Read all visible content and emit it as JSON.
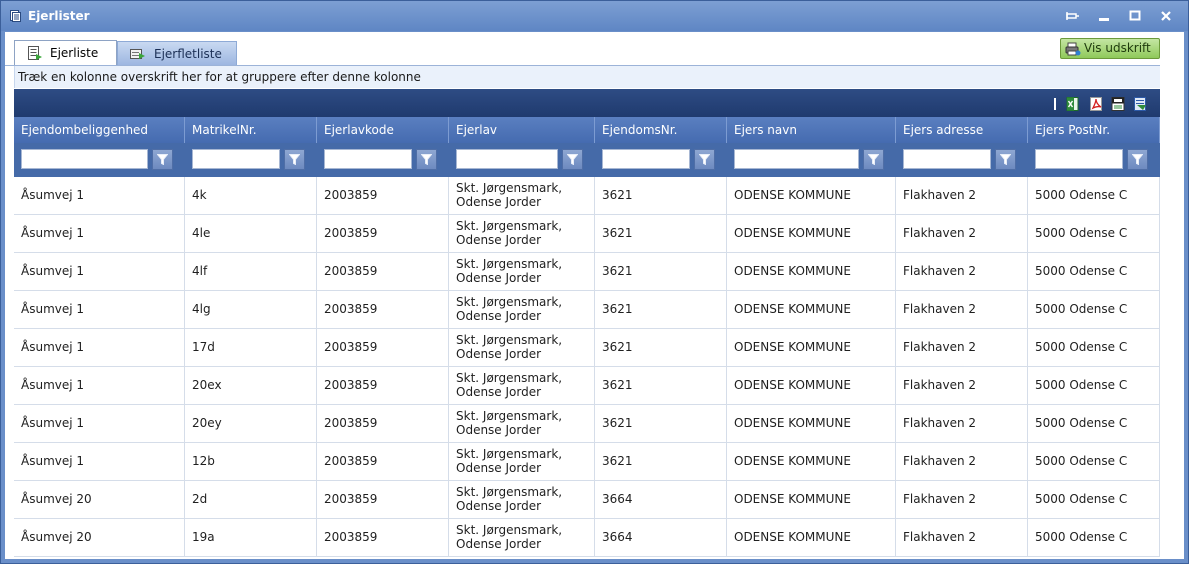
{
  "window": {
    "title": "Ejerlister"
  },
  "tabs": [
    {
      "label": "Ejerliste",
      "active": true
    },
    {
      "label": "Ejerfletliste",
      "active": false
    }
  ],
  "print_button": {
    "label": "Vis udskrift"
  },
  "group_hint": "Træk en kolonne overskrift her for at gruppere efter denne kolonne",
  "toolbar_icons": [
    "excel-export-icon",
    "pdf-export-icon",
    "csv-export-icon",
    "word-export-icon"
  ],
  "columns": [
    "Ejendombeliggenhed",
    "MatrikelNr.",
    "Ejerlavkode",
    "Ejerlav",
    "EjendomsNr.",
    "Ejers navn",
    "Ejers adresse",
    "Ejers PostNr."
  ],
  "filters": [
    "",
    "",
    "",
    "",
    "",
    "",
    "",
    ""
  ],
  "rows": [
    [
      "Åsumvej 1",
      "4k",
      "2003859",
      "Skt. Jørgensmark,\nOdense Jorder",
      "3621",
      "ODENSE KOMMUNE",
      "Flakhaven 2",
      "5000 Odense C"
    ],
    [
      "Åsumvej 1",
      "4le",
      "2003859",
      "Skt. Jørgensmark,\nOdense Jorder",
      "3621",
      "ODENSE KOMMUNE",
      "Flakhaven 2",
      "5000 Odense C"
    ],
    [
      "Åsumvej 1",
      "4lf",
      "2003859",
      "Skt. Jørgensmark,\nOdense Jorder",
      "3621",
      "ODENSE KOMMUNE",
      "Flakhaven 2",
      "5000 Odense C"
    ],
    [
      "Åsumvej 1",
      "4lg",
      "2003859",
      "Skt. Jørgensmark,\nOdense Jorder",
      "3621",
      "ODENSE KOMMUNE",
      "Flakhaven 2",
      "5000 Odense C"
    ],
    [
      "Åsumvej 1",
      "17d",
      "2003859",
      "Skt. Jørgensmark,\nOdense Jorder",
      "3621",
      "ODENSE KOMMUNE",
      "Flakhaven 2",
      "5000 Odense C"
    ],
    [
      "Åsumvej 1",
      "20ex",
      "2003859",
      "Skt. Jørgensmark,\nOdense Jorder",
      "3621",
      "ODENSE KOMMUNE",
      "Flakhaven 2",
      "5000 Odense C"
    ],
    [
      "Åsumvej 1",
      "20ey",
      "2003859",
      "Skt. Jørgensmark,\nOdense Jorder",
      "3621",
      "ODENSE KOMMUNE",
      "Flakhaven 2",
      "5000 Odense C"
    ],
    [
      "Åsumvej 1",
      "12b",
      "2003859",
      "Skt. Jørgensmark,\nOdense Jorder",
      "3621",
      "ODENSE KOMMUNE",
      "Flakhaven 2",
      "5000 Odense C"
    ],
    [
      "Åsumvej 20",
      "2d",
      "2003859",
      "Skt. Jørgensmark,\nOdense Jorder",
      "3664",
      "ODENSE KOMMUNE",
      "Flakhaven 2",
      "5000 Odense C"
    ],
    [
      "Åsumvej 20",
      "19a",
      "2003859",
      "Skt. Jørgensmark,\nOdense Jorder",
      "3664",
      "ODENSE KOMMUNE",
      "Flakhaven 2",
      "5000 Odense C"
    ]
  ],
  "colors": {
    "titlebar": "#6a8fc9",
    "header": "#456bb0",
    "toolbar": "#1f3a6e",
    "print_button": "#8fc95a"
  }
}
